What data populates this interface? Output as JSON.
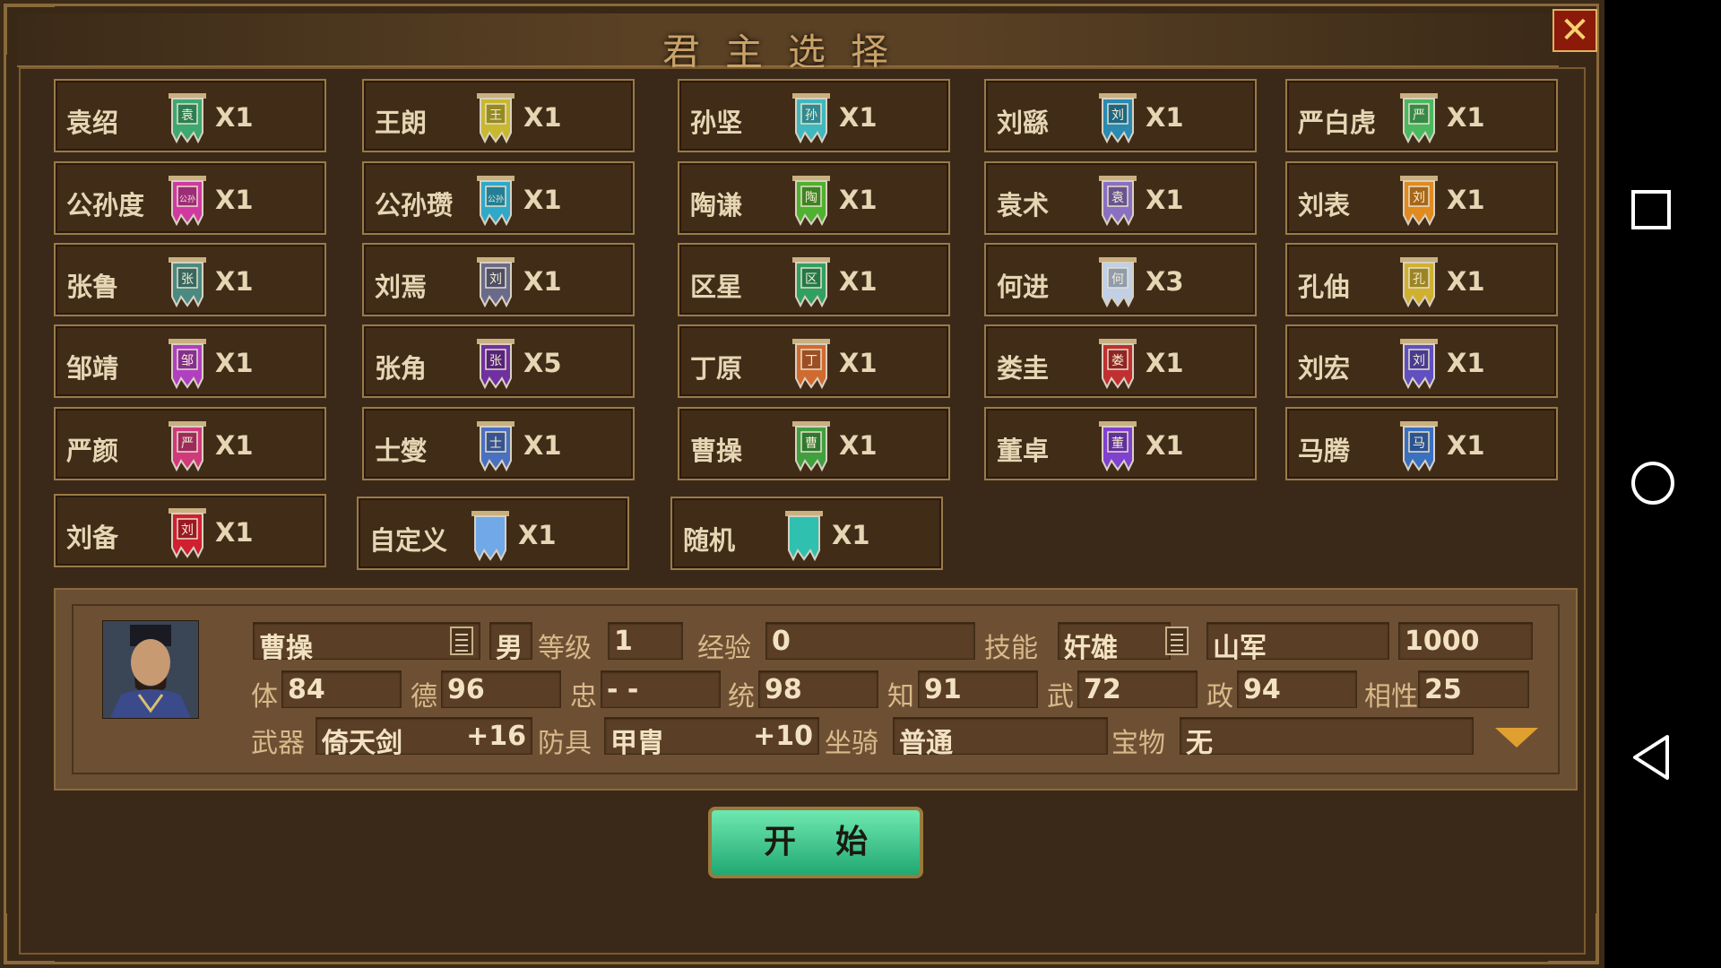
{
  "window": {
    "title": "君主选择",
    "close_label": "✕"
  },
  "lords": [
    {
      "name": "袁绍",
      "count": "X1",
      "flag": "袁",
      "color": "#3da870"
    },
    {
      "name": "王朗",
      "count": "X1",
      "flag": "王",
      "color": "#c8b830"
    },
    {
      "name": "孙坚",
      "count": "X1",
      "flag": "孙",
      "color": "#40b8c0"
    },
    {
      "name": "刘繇",
      "count": "X1",
      "flag": "刘",
      "color": "#2a8ab0"
    },
    {
      "name": "严白虎",
      "count": "X1",
      "flag": "严",
      "color": "#4ab860"
    },
    {
      "name": "公孙度",
      "count": "X1",
      "flag": "公孙",
      "color": "#d03aa0"
    },
    {
      "name": "公孙瓒",
      "count": "X1",
      "flag": "公孙",
      "color": "#30a8c8"
    },
    {
      "name": "陶谦",
      "count": "X1",
      "flag": "陶",
      "color": "#50b030"
    },
    {
      "name": "袁术",
      "count": "X1",
      "flag": "袁",
      "color": "#8a70c0"
    },
    {
      "name": "刘表",
      "count": "X1",
      "flag": "刘",
      "color": "#e08a20"
    },
    {
      "name": "张鲁",
      "count": "X1",
      "flag": "张",
      "color": "#4a8a80"
    },
    {
      "name": "刘焉",
      "count": "X1",
      "flag": "刘",
      "color": "#6a6a8a"
    },
    {
      "name": "区星",
      "count": "X1",
      "flag": "区",
      "color": "#30a060"
    },
    {
      "name": "何进",
      "count": "X3",
      "flag": "何",
      "color": "#c0d0e8"
    },
    {
      "name": "孔伷",
      "count": "X1",
      "flag": "孔",
      "color": "#d0b030"
    },
    {
      "name": "邹靖",
      "count": "X1",
      "flag": "邹",
      "color": "#b040c0"
    },
    {
      "name": "张角",
      "count": "X5",
      "flag": "张",
      "color": "#7030a0"
    },
    {
      "name": "丁原",
      "count": "X1",
      "flag": "丁",
      "color": "#d06a30"
    },
    {
      "name": "娄圭",
      "count": "X1",
      "flag": "娄",
      "color": "#c03030"
    },
    {
      "name": "刘宏",
      "count": "X1",
      "flag": "刘",
      "color": "#6050c0"
    },
    {
      "name": "严颜",
      "count": "X1",
      "flag": "严",
      "color": "#d03a7a"
    },
    {
      "name": "士燮",
      "count": "X1",
      "flag": "士",
      "color": "#4a70c0"
    },
    {
      "name": "曹操",
      "count": "X1",
      "flag": "曹",
      "color": "#40a040"
    },
    {
      "name": "董卓",
      "count": "X1",
      "flag": "董",
      "color": "#8040d0"
    },
    {
      "name": "马腾",
      "count": "X1",
      "flag": "马",
      "color": "#3a70c0"
    },
    {
      "name": "刘备",
      "count": "X1",
      "flag": "刘",
      "color": "#d02030"
    },
    {
      "name": "自定义",
      "count": "X1",
      "flag": "",
      "color": "#70a8e8"
    },
    {
      "name": "随机",
      "count": "X1",
      "flag": "",
      "color": "#30c0b0"
    }
  ],
  "info": {
    "name": "曹操",
    "gender": "男",
    "level_label": "等级",
    "level": "1",
    "exp_label": "经验",
    "exp": "0",
    "skill_label": "技能",
    "skill": "奸雄",
    "terrain": "山军",
    "gold": "1000",
    "stats": [
      {
        "label": "体",
        "value": "84"
      },
      {
        "label": "德",
        "value": "96"
      },
      {
        "label": "忠",
        "value": "- -"
      },
      {
        "label": "统",
        "value": "98"
      },
      {
        "label": "知",
        "value": "91"
      },
      {
        "label": "武",
        "value": "72"
      },
      {
        "label": "政",
        "value": "94"
      },
      {
        "label": "相性",
        "value": "25"
      }
    ],
    "weapon_label": "武器",
    "weapon": "倚天剑",
    "weapon_bonus": "+16",
    "armor_label": "防具",
    "armor": "甲胄",
    "armor_bonus": "+10",
    "mount_label": "坐骑",
    "mount": "普通",
    "treasure_label": "宝物",
    "treasure": "无"
  },
  "start_label": "开始",
  "navbar": {
    "icons": [
      "recents-square-icon",
      "home-circle-icon",
      "back-triangle-icon"
    ]
  }
}
